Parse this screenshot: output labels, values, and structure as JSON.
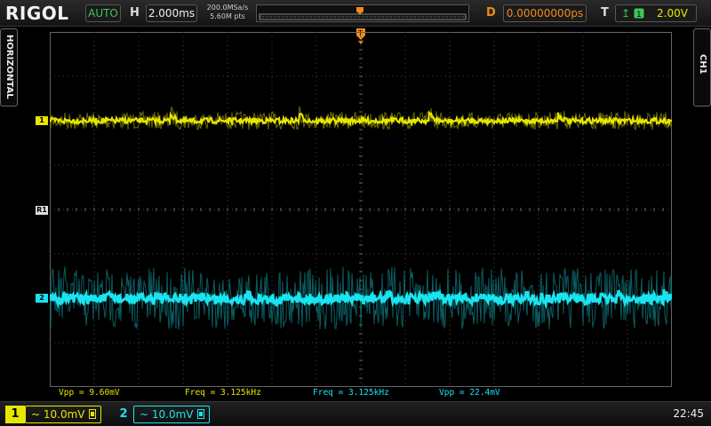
{
  "topbar": {
    "brand": "RIGOL",
    "run_mode": "AUTO",
    "horizontal_label": "H",
    "timebase": "2.000ms",
    "sample_rate": "200.0MSa/s",
    "memory_depth": "5.60M pts",
    "delay_label": "D",
    "delay": "0.00000000ps",
    "trigger_label": "T",
    "trigger_level": "2.00V"
  },
  "side_tabs": {
    "left": "HORIZONTAL",
    "right": "CH1"
  },
  "markers": {
    "ch1": "1",
    "ch2": "2",
    "ref": "R1"
  },
  "measurements": [
    {
      "text": "Vpp = 9.60mV"
    },
    {
      "text": "Freq = 3.125kHz"
    },
    {
      "text": "Freq = 3.125kHz"
    },
    {
      "text": "Vpp = 22.4mV"
    }
  ],
  "channels": [
    {
      "number": "1",
      "coupling_icon": "tilde",
      "scale": "10.0mV"
    },
    {
      "number": "2",
      "coupling_icon": "tilde",
      "scale": "10.0mV"
    }
  ],
  "clock": "22:45",
  "colors": {
    "ch1": "#e6e600",
    "ch2": "#19e4f0",
    "trigger": "#f08a1c",
    "run_mode": "#3cc65a"
  }
}
